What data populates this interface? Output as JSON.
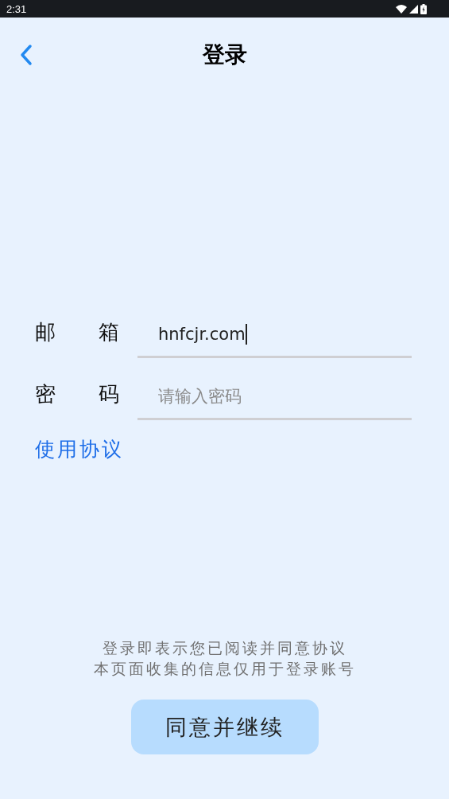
{
  "status_bar": {
    "time": "2:31"
  },
  "header": {
    "title": "登录"
  },
  "fields": [
    {
      "label": "邮 箱",
      "value": "hnfcjr.com",
      "focused": true
    },
    {
      "label": "密 码",
      "placeholder": "请输入密码",
      "focused": false
    }
  ],
  "agreement_link": "使用协议",
  "notice": [
    "登录即表示您已阅读并同意协议",
    "本页面收集的信息仅用于登录账号"
  ],
  "button": "同意并继续"
}
